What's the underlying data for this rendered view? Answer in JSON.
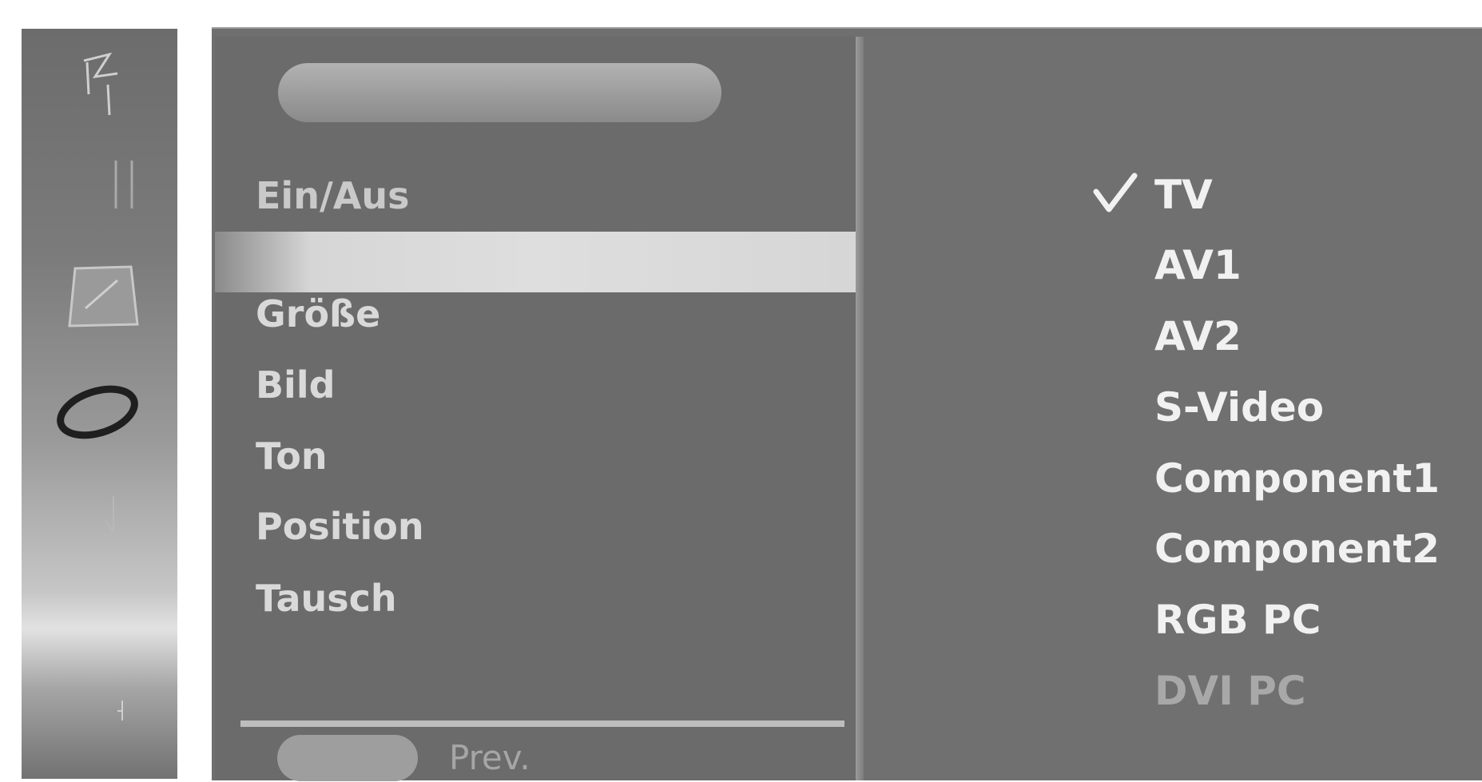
{
  "menu": {
    "items": [
      {
        "label": "Ein/Aus"
      },
      {
        "label": ""
      },
      {
        "label": "Größe"
      },
      {
        "label": "Bild"
      },
      {
        "label": "Ton"
      },
      {
        "label": "Position"
      },
      {
        "label": "Tausch"
      }
    ],
    "highlighted_index": 1,
    "footer": {
      "prev_label": "Prev."
    }
  },
  "sources": {
    "items": [
      {
        "label": "TV",
        "checked": true,
        "enabled": true
      },
      {
        "label": "AV1",
        "checked": false,
        "enabled": true
      },
      {
        "label": "AV2",
        "checked": false,
        "enabled": true
      },
      {
        "label": "S-Video",
        "checked": false,
        "enabled": true
      },
      {
        "label": "Component1",
        "checked": false,
        "enabled": true
      },
      {
        "label": "Component2",
        "checked": false,
        "enabled": true
      },
      {
        "label": "RGB PC",
        "checked": false,
        "enabled": true
      },
      {
        "label": "DVI PC",
        "checked": false,
        "enabled": false
      }
    ]
  },
  "icons": [
    "antenna-icon",
    "pause-bars-icon",
    "screen-card-icon",
    "disc-ring-icon",
    "small-arrow-icon",
    "lock-tick-icon"
  ],
  "colors": {
    "panel_bg": "#6b6b6b",
    "highlight": "#dedede",
    "text_primary": "#f1f1f1",
    "text_disabled": "#a8a8a8"
  }
}
